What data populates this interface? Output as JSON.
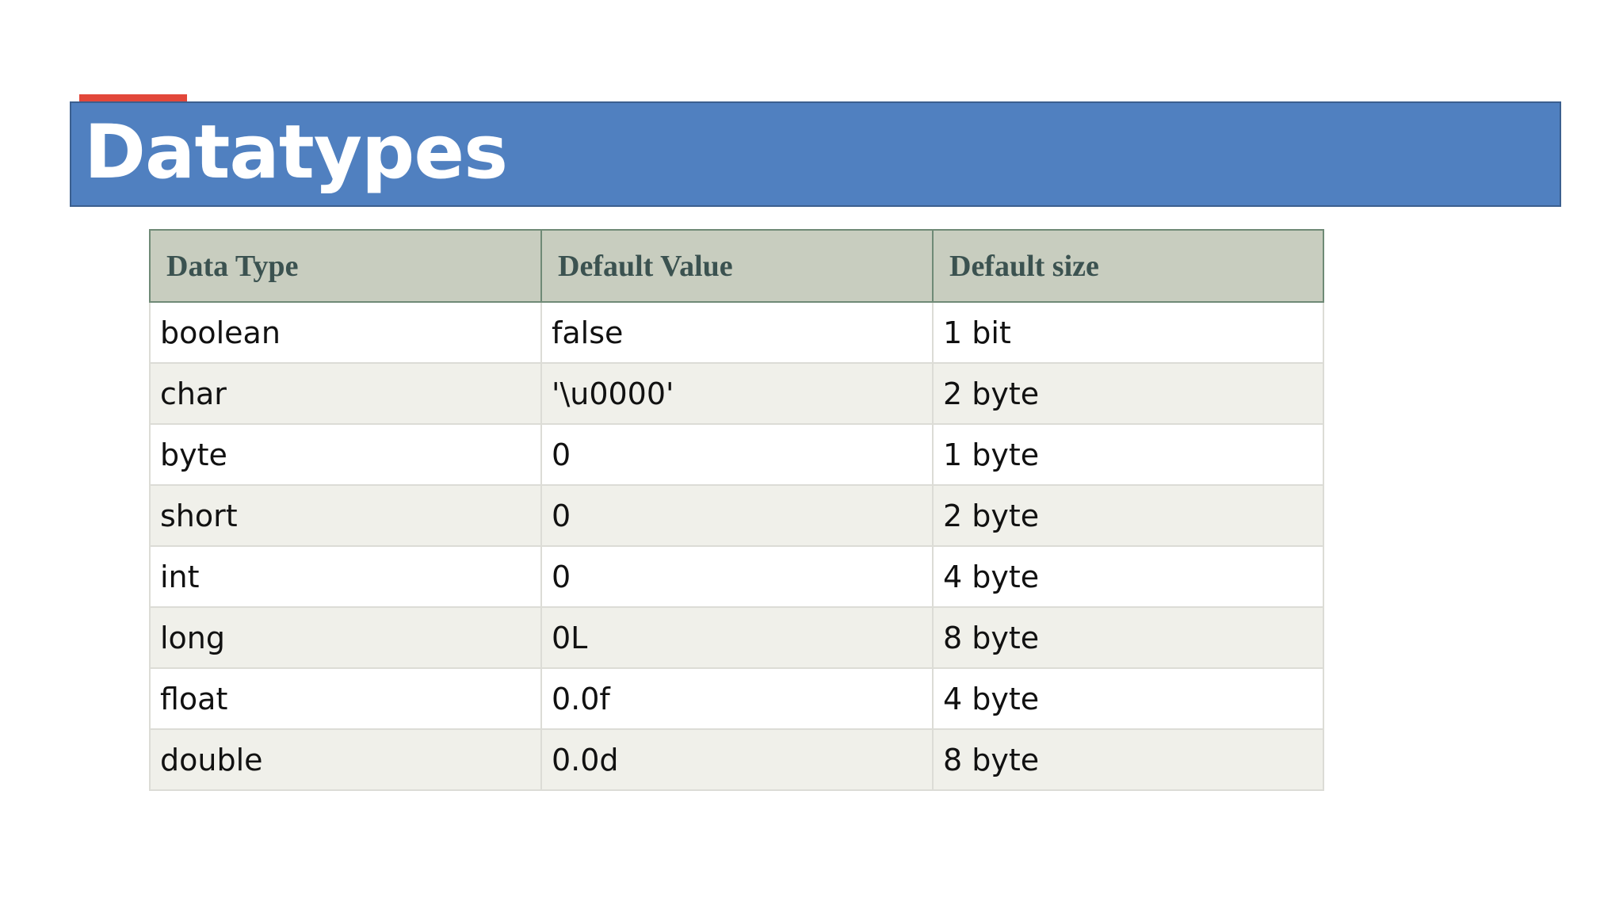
{
  "slide": {
    "title": "Datatypes",
    "colors": {
      "accent": "#e2473a",
      "banner": "#5080c0",
      "header_bg": "#c8cdbf",
      "header_text": "#3b5250",
      "row_alt": "#f0f0ea"
    }
  },
  "table": {
    "headers": [
      "Data Type",
      "Default Value",
      "Default size"
    ],
    "rows": [
      [
        "boolean",
        "false",
        "1 bit"
      ],
      [
        "char",
        "'\\u0000'",
        "2 byte"
      ],
      [
        "byte",
        "0",
        "1 byte"
      ],
      [
        "short",
        "0",
        "2 byte"
      ],
      [
        "int",
        "0",
        "4 byte"
      ],
      [
        "long",
        "0L",
        "8 byte"
      ],
      [
        "float",
        "0.0f",
        "4 byte"
      ],
      [
        "double",
        "0.0d",
        "8 byte"
      ]
    ]
  }
}
